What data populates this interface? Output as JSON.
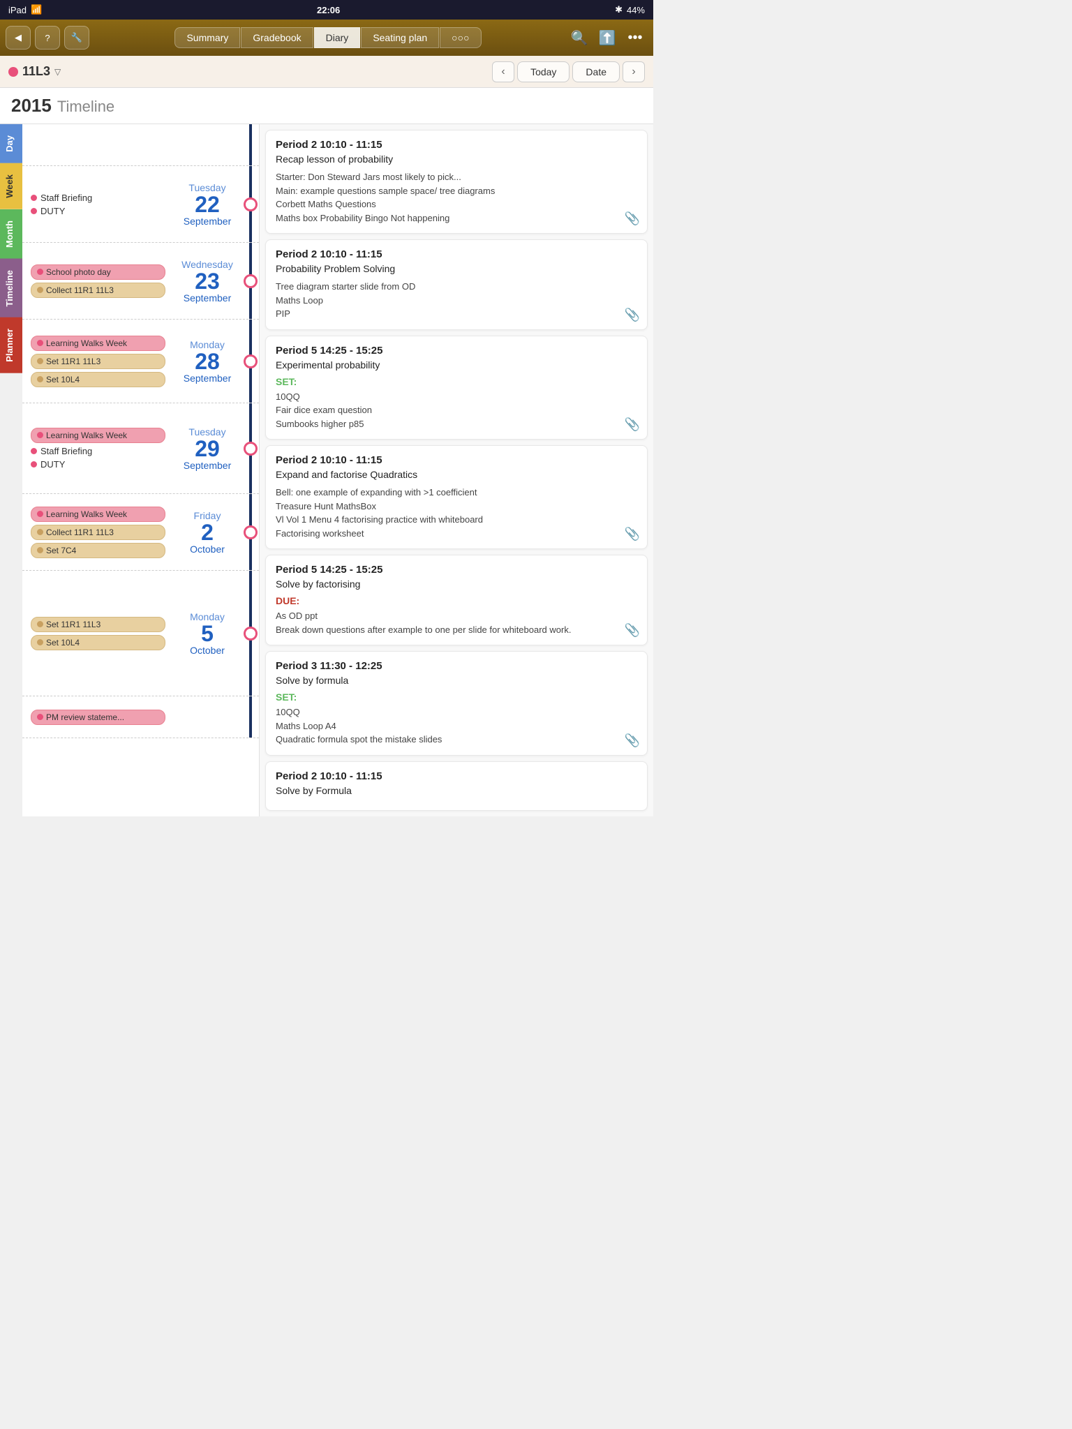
{
  "statusBar": {
    "left": "iPad",
    "wifi": "WiFi",
    "time": "22:06",
    "bluetooth": "BT",
    "battery": "44%"
  },
  "tabs": [
    {
      "label": "Summary",
      "active": false
    },
    {
      "label": "Gradebook",
      "active": false
    },
    {
      "label": "Diary",
      "active": true
    },
    {
      "label": "Seating plan",
      "active": false
    },
    {
      "label": "○○○",
      "active": false
    }
  ],
  "secondaryBar": {
    "className": "11L3",
    "todayBtn": "Today",
    "dateBtn": "Date"
  },
  "yearHeader": {
    "year": "2015",
    "view": "Timeline"
  },
  "sideTabs": [
    {
      "label": "Day",
      "color": "day"
    },
    {
      "label": "Week",
      "color": "week"
    },
    {
      "label": "Month",
      "color": "month"
    },
    {
      "label": "Timeline",
      "color": "timeline"
    },
    {
      "label": "Planner",
      "color": "planner"
    }
  ],
  "dateRows": [
    {
      "id": "top-partial",
      "tags": [],
      "date": null,
      "entries": [
        {
          "header": "Period 2   10:10 - 11:15",
          "title": "Recap lesson of probability",
          "body": "Starter: Don Steward Jars most likely to pick...\nMain: example questions sample space/ tree diagrams\nCorbett Maths Questions\nMaths box Probability Bingo Not happening",
          "label": null,
          "hasAttachment": true
        }
      ]
    },
    {
      "id": "tue-22-sep",
      "tags": [
        {
          "type": "plain",
          "dot": "pink",
          "text": "Staff Briefing"
        },
        {
          "type": "plain",
          "dot": "pink",
          "text": "DUTY"
        }
      ],
      "dayName": "Tuesday",
      "dayNum": "22",
      "monthName": "September",
      "entries": [
        {
          "header": "Period 2   10:10 - 11:15",
          "title": "Probability Problem Solving",
          "body": "Tree diagram starter slide from OD\nMaths Loop\nPIP",
          "label": null,
          "hasAttachment": true
        }
      ]
    },
    {
      "id": "wed-23-sep",
      "tags": [
        {
          "type": "pill",
          "dot": "pink",
          "text": "School photo day",
          "style": "pink"
        },
        {
          "type": "pill",
          "dot": "tan",
          "text": "Collect 11R1 11L3",
          "style": "tan"
        }
      ],
      "dayName": "Wednesday",
      "dayNum": "23",
      "monthName": "September",
      "entries": [
        {
          "header": "Period 5   14:25 - 15:25",
          "title": "Experimental probability",
          "setLabel": "SET:",
          "body": "10QQ\nFair dice exam question\nSumbooks higher p85",
          "label": "set",
          "hasAttachment": true
        }
      ]
    },
    {
      "id": "mon-28-sep",
      "tags": [
        {
          "type": "pill",
          "dot": "pink",
          "text": "Learning Walks Week",
          "style": "pink"
        },
        {
          "type": "pill",
          "dot": "tan",
          "text": "Set 11R1 11L3",
          "style": "tan"
        },
        {
          "type": "pill",
          "dot": "tan",
          "text": "Set 10L4",
          "style": "tan"
        }
      ],
      "dayName": "Monday",
      "dayNum": "28",
      "monthName": "September",
      "entries": [
        {
          "header": "Period 2   10:10 - 11:15",
          "title": "Expand and factorise Quadratics",
          "body": "Bell: one example of expanding with >1 coefficient\nTreasure Hunt MathsBox\nVl Vol 1 Menu 4 factorising practice with whiteboard\nFactorising worksheet",
          "label": null,
          "hasAttachment": true
        }
      ]
    },
    {
      "id": "tue-29-sep",
      "tags": [
        {
          "type": "pill",
          "dot": "pink",
          "text": "Learning Walks Week",
          "style": "pink"
        },
        {
          "type": "plain",
          "dot": "pink",
          "text": "Staff Briefing"
        },
        {
          "type": "plain",
          "dot": "pink",
          "text": "DUTY"
        }
      ],
      "dayName": "Tuesday",
      "dayNum": "29",
      "monthName": "September",
      "entries": [
        {
          "header": "Period 5   14:25 - 15:25",
          "title": "Solve by factorising",
          "dueLabel": "DUE:",
          "body": "As OD ppt\nBreak down questions after example to one per slide for whiteboard work.",
          "label": "due",
          "hasAttachment": true
        },
        {
          "header": "Period 3   11:30 - 12:25",
          "title": "Solve by formula",
          "setLabel": "SET:",
          "body": "10QQ\nMaths Loop A4\nQuadratic formula spot the mistake slides",
          "label": "set",
          "hasAttachment": false
        }
      ]
    },
    {
      "id": "fri-2-oct",
      "tags": [
        {
          "type": "pill",
          "dot": "pink",
          "text": "Learning Walks Week",
          "style": "pink"
        },
        {
          "type": "pill",
          "dot": "tan",
          "text": "Collect 11R1 11L3",
          "style": "tan"
        },
        {
          "type": "pill",
          "dot": "tan",
          "text": "Set 7C4",
          "style": "tan"
        }
      ],
      "dayName": "Friday",
      "dayNum": "2",
      "monthName": "October",
      "entries": []
    },
    {
      "id": "mon-5-oct",
      "tags": [
        {
          "type": "pill",
          "dot": "tan",
          "text": "Set 11R1 11L3",
          "style": "tan"
        },
        {
          "type": "pill",
          "dot": "tan",
          "text": "Set 10L4",
          "style": "tan"
        }
      ],
      "dayName": "Monday",
      "dayNum": "5",
      "monthName": "October",
      "entries": [
        {
          "header": "Period 3   11:30 - 12:25",
          "title": "Solve by formula",
          "setLabel": "SET:",
          "body": "10QQ\nMaths Loop A4\nQuadratic formula spot the mistake slides",
          "label": "set",
          "hasAttachment": true
        },
        {
          "header": "Period 2   10:10 - 11:15",
          "title": "Solve by Formula",
          "body": "",
          "label": null,
          "hasAttachment": false
        }
      ]
    },
    {
      "id": "partial-bottom",
      "tags": [
        {
          "type": "pill",
          "dot": "pink",
          "text": "PM review stateme...",
          "style": "pink"
        }
      ],
      "date": null,
      "entries": []
    }
  ]
}
